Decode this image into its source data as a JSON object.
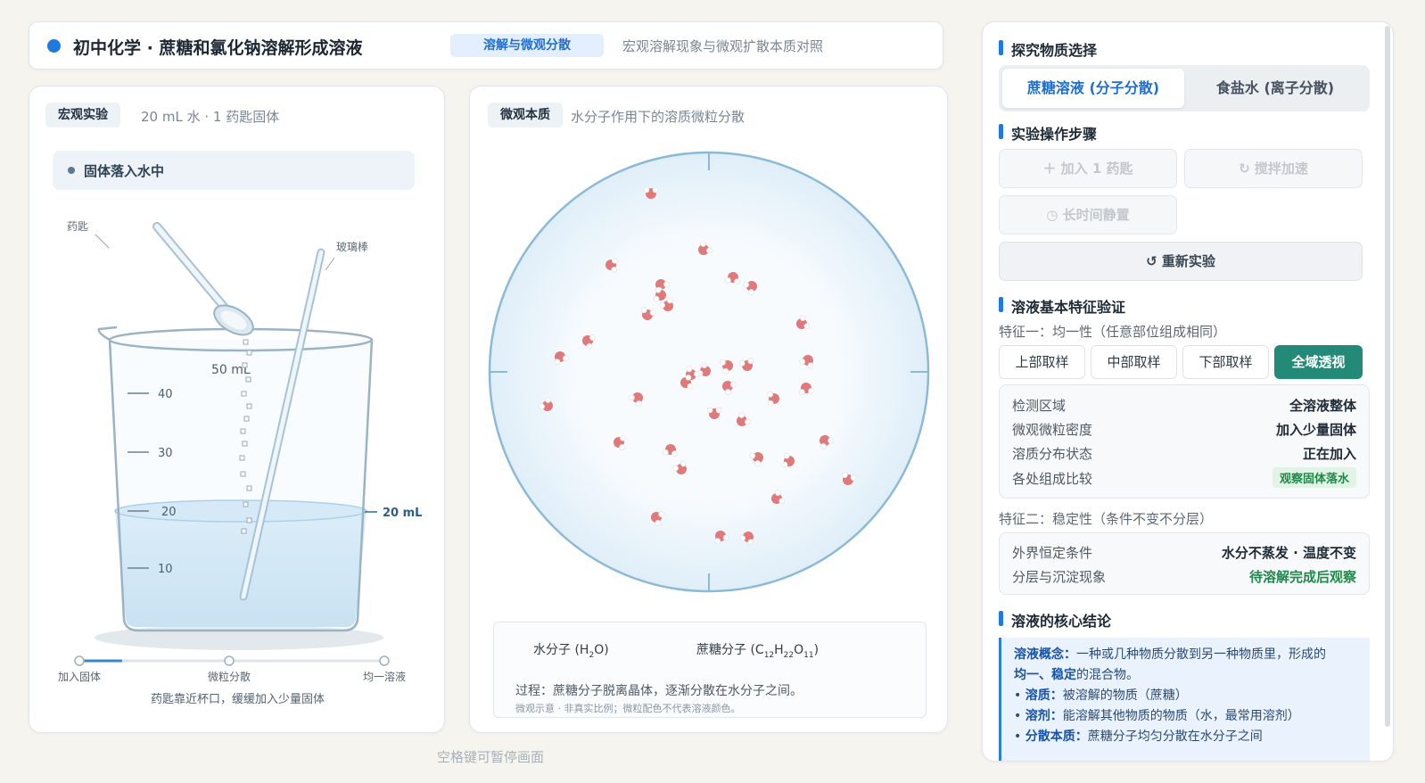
{
  "header": {
    "title": "初中化学 · 蔗糖和氯化钠溶解形成溶液",
    "tag": "溶解与微观分散",
    "subtitle": "宏观溶解现象与微观扩散本质对照"
  },
  "macro": {
    "chip": "宏观实验",
    "note": "20 mL 水 · 1 药匙固体",
    "status": "固体落入水中",
    "label_spoon": "药匙",
    "label_rod": "玻璃棒",
    "beaker_marks": [
      "50 mL",
      "40",
      "30",
      "20",
      "10"
    ],
    "water_level_label": "20 mL",
    "progress_steps": [
      "加入固体",
      "微粒分散",
      "均一溶液"
    ],
    "progress_fraction": 0.14,
    "hint": "药匙靠近杯口，缓缓加入少量固体"
  },
  "micro": {
    "chip": "微观本质",
    "note": "水分子作用下的溶质微粒分散",
    "legend": {
      "water": "水分子 (H",
      "water_sub": "2",
      "water_end": "O)",
      "sugar": "蔗糖分子 (C",
      "sugar_sub1": "12",
      "sugar_h": "H",
      "sugar_sub2": "22",
      "sugar_o": "O",
      "sugar_sub3": "11",
      "sugar_end": ")",
      "process": "过程：蔗糖分子脱离晶体，逐渐分散在水分子之间。",
      "note": "微观示意 · 非真实比例；微粒配色不代表溶液颜色。"
    },
    "colors": {
      "water": "#e07a7a",
      "sugar": "#f29a1c"
    }
  },
  "pause_hint": "空格键可暂停画面",
  "sidebar": {
    "sec_material": "探究物质选择",
    "options": [
      "蔗糖溶液 (分子分散)",
      "食盐水 (离子分散)"
    ],
    "sec_steps": "实验操作步骤",
    "btn_add": "加入 1 药匙",
    "btn_stir": "搅拌加速",
    "btn_wait": "长时间静置",
    "btn_reset": "重新实验",
    "sec_features": "溶液基本特征验证",
    "feature1": "特征一：均一性（任意部位组成相同）",
    "sample_buttons": [
      "上部取样",
      "中部取样",
      "下部取样",
      "全域透视"
    ],
    "kv1": [
      {
        "k": "检测区域",
        "v": "全溶液整体"
      },
      {
        "k": "微观微粒密度",
        "v": "加入少量固体"
      },
      {
        "k": "溶质分布状态",
        "v": "正在加入"
      },
      {
        "k": "各处组成比较",
        "v": "观察固体落水"
      }
    ],
    "feature2": "特征二：稳定性（条件不变不分层）",
    "kv2": [
      {
        "k": "外界恒定条件",
        "v": "水分不蒸发 · 温度不变"
      },
      {
        "k": "分层与沉淀现象",
        "v": "待溶解完成后观察"
      }
    ],
    "sec_conclusion": "溶液的核心结论",
    "conclusion": {
      "c1_label": "溶液概念：",
      "c1_text": "一种或几种物质分散到另一种物质里，形成的",
      "c1_b2": "均一、稳定",
      "c1_end": "的混合物。",
      "c2_label": "溶质：",
      "c2_text": "被溶解的物质（蔗糖）",
      "c3_label": "溶剂：",
      "c3_text": "能溶解其他物质的物质（水，最常用溶剂）",
      "c4_label": "分散本质：",
      "c4_text": "蔗糖分子均匀分散在水分子之间"
    }
  }
}
